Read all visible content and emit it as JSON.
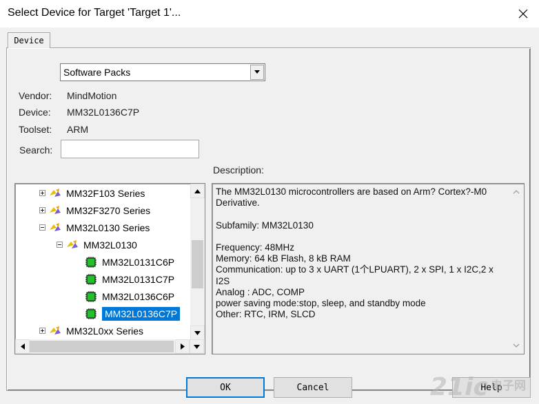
{
  "window": {
    "title": "Select Device for Target 'Target 1'..."
  },
  "tabs": [
    {
      "label": "Device"
    }
  ],
  "source_select": {
    "value": "Software Packs"
  },
  "info": {
    "vendor_label": "Vendor:",
    "vendor": "MindMotion",
    "device_label": "Device:",
    "device": "MM32L0136C7P",
    "toolset_label": "Toolset:",
    "toolset": "ARM",
    "search_label": "Search:",
    "search_value": ""
  },
  "tree": {
    "items": [
      {
        "label": "MM32F103 Series"
      },
      {
        "label": "MM32F3270 Series"
      },
      {
        "label": "MM32L0130 Series"
      },
      {
        "label": "MM32L0130"
      },
      {
        "label": "MM32L0131C6P"
      },
      {
        "label": "MM32L0131C7P"
      },
      {
        "label": "MM32L0136C6P"
      },
      {
        "label": "MM32L0136C7P"
      },
      {
        "label": "MM32L0xx Series"
      }
    ]
  },
  "description": {
    "label": "Description:",
    "lines": [
      "The MM32L0130 microcontrollers are based on Arm? Cortex?-M0",
      "Derivative.",
      "",
      "Subfamily: MM32L0130",
      "",
      "Frequency: 48MHz",
      "Memory: 64 kB Flash, 8 kB RAM",
      "Communication: up to 3 x UART (1个LPUART), 2 x SPI, 1 x I2C,2 x",
      "I2S",
      "Analog : ADC, COMP",
      "power saving mode:stop, sleep, and standby mode",
      "Other: RTC, IRM, SLCD"
    ]
  },
  "buttons": {
    "ok": "OK",
    "cancel": "Cancel",
    "help": "Help"
  },
  "watermark": {
    "text": "21ic",
    "sub": "电子网"
  },
  "colors": {
    "selection": "#0078d7",
    "chip_green": "#22c02a"
  }
}
